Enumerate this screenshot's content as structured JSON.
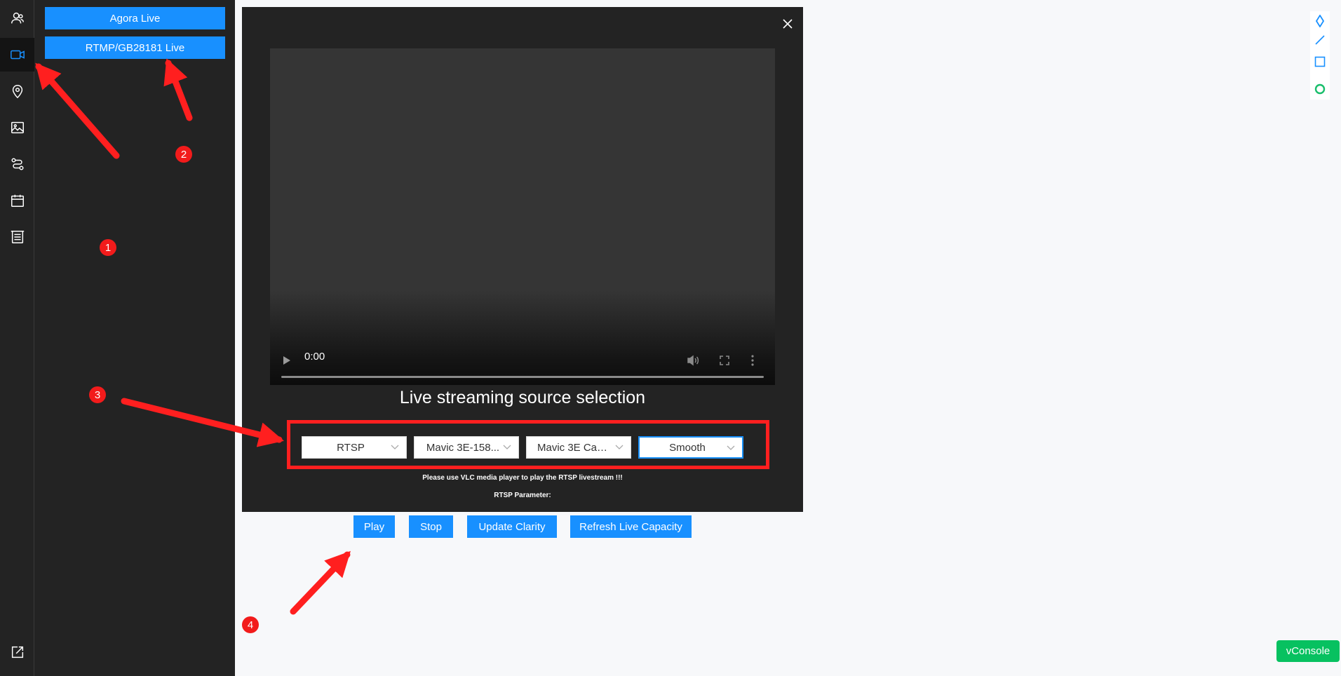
{
  "sidebar": {
    "agora_label": "Agora Live",
    "rtmp_label": "RTMP/GB28181 Live"
  },
  "dialog": {
    "time": "0:00",
    "source_title": "Live streaming source selection",
    "selects": {
      "protocol": "RTSP",
      "device": "Mavic 3E-158...",
      "camera": "Mavic 3E Cam...",
      "clarity": "Smooth"
    },
    "note": "Please use VLC media player to play the RTSP livestream !!!",
    "param_label": "RTSP Parameter:"
  },
  "actions": {
    "play": "Play",
    "stop": "Stop",
    "update_clarity": "Update Clarity",
    "refresh": "Refresh Live Capacity"
  },
  "vconsole_label": "vConsole",
  "annotations": {
    "step1": "1",
    "step2": "2",
    "step3": "3",
    "step4": "4"
  },
  "colors": {
    "accent": "#1890ff",
    "annotation": "#ff1f1f",
    "vconsole": "#07c160"
  }
}
